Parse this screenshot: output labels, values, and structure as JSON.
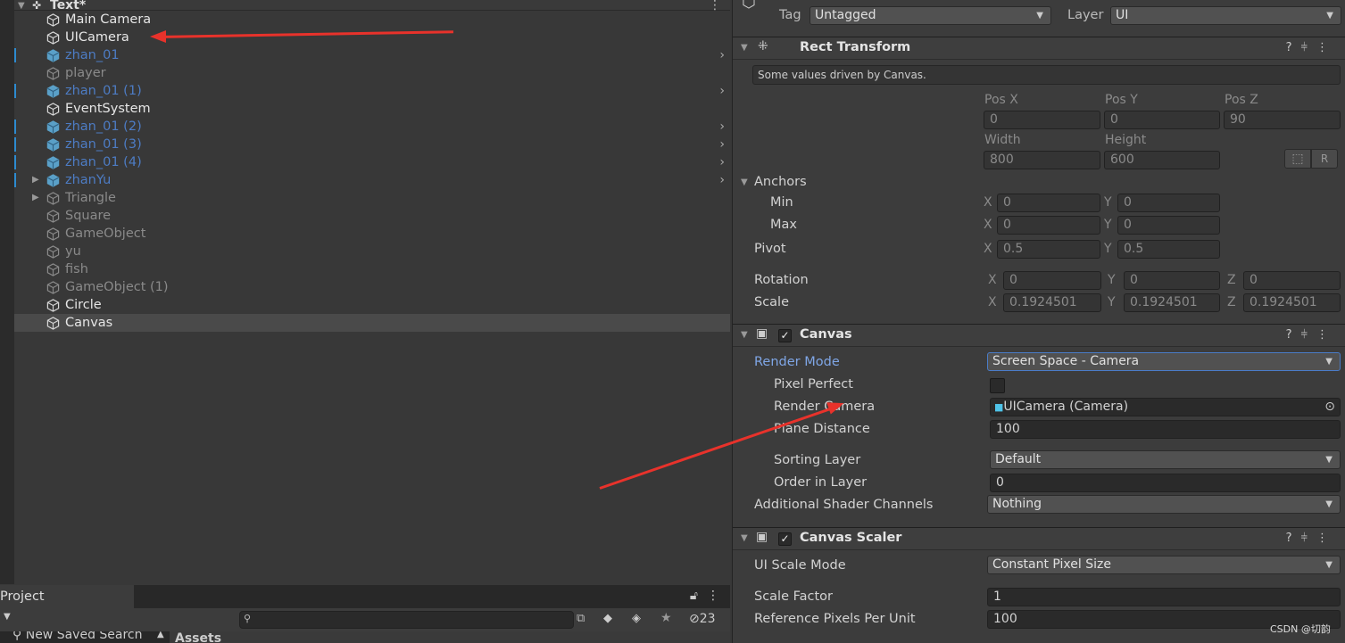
{
  "hierarchy": {
    "scene_name": "Text*",
    "items": [
      {
        "label": "Main Camera",
        "style": "norm"
      },
      {
        "label": "UICamera",
        "style": "norm"
      },
      {
        "label": "zhan_01",
        "style": "pref",
        "chevron": true
      },
      {
        "label": "player",
        "style": "dis"
      },
      {
        "label": "zhan_01 (1)",
        "style": "pref",
        "chevron": true
      },
      {
        "label": "EventSystem",
        "style": "norm"
      },
      {
        "label": "zhan_01 (2)",
        "style": "pref",
        "chevron": true
      },
      {
        "label": "zhan_01 (3)",
        "style": "pref",
        "chevron": true
      },
      {
        "label": "zhan_01 (4)",
        "style": "pref",
        "chevron": true
      },
      {
        "label": "zhanYu",
        "style": "pref",
        "chevron": true,
        "fold": true
      },
      {
        "label": "Triangle",
        "style": "dis",
        "fold": true
      },
      {
        "label": "Square",
        "style": "dis"
      },
      {
        "label": "GameObject",
        "style": "dis"
      },
      {
        "label": "yu",
        "style": "dis"
      },
      {
        "label": "fish",
        "style": "dis"
      },
      {
        "label": "GameObject (1)",
        "style": "dis"
      },
      {
        "label": "Circle",
        "style": "norm"
      },
      {
        "label": "Canvas",
        "style": "norm",
        "selected": true
      }
    ]
  },
  "project": {
    "tab": "Project",
    "saved_search": "New Saved Search",
    "assets": "Assets",
    "hidden_count": "23",
    "search_placeholder": ""
  },
  "inspector": {
    "tag_label": "Tag",
    "tag_value": "Untagged",
    "layer_label": "Layer",
    "layer_value": "UI",
    "rect_transform": {
      "title": "Rect Transform",
      "note": "Some values driven by Canvas.",
      "pos_x_label": "Pos X",
      "pos_y_label": "Pos Y",
      "pos_z_label": "Pos Z",
      "pos_x": "0",
      "pos_y": "0",
      "pos_z": "90",
      "width_label": "Width",
      "height_label": "Height",
      "width": "800",
      "height": "600",
      "anchors": "Anchors",
      "min": "Min",
      "max": "Max",
      "min_x": "0",
      "min_y": "0",
      "max_x": "0",
      "max_y": "0",
      "pivot": "Pivot",
      "pivot_x": "0.5",
      "pivot_y": "0.5",
      "rotation": "Rotation",
      "rot_x": "0",
      "rot_y": "0",
      "rot_z": "0",
      "scale": "Scale",
      "scale_x": "0.1924501",
      "scale_y": "0.1924501",
      "scale_z": "0.1924501",
      "x": "X",
      "y": "Y",
      "z": "Z",
      "r_button": "R"
    },
    "canvas": {
      "title": "Canvas",
      "render_mode_label": "Render Mode",
      "render_mode": "Screen Space - Camera",
      "pixel_perfect_label": "Pixel Perfect",
      "pixel_perfect": false,
      "render_camera_label": "Render Camera",
      "render_camera": "UICamera (Camera)",
      "plane_distance_label": "Plane Distance",
      "plane_distance": "100",
      "sorting_layer_label": "Sorting Layer",
      "sorting_layer": "Default",
      "order_label": "Order in Layer",
      "order": "0",
      "shader_channels_label": "Additional Shader Channels",
      "shader_channels": "Nothing"
    },
    "canvas_scaler": {
      "title": "Canvas Scaler",
      "ui_scale_mode_label": "UI Scale Mode",
      "ui_scale_mode": "Constant Pixel Size",
      "scale_factor_label": "Scale Factor",
      "scale_factor": "1",
      "ref_ppu_label": "Reference Pixels Per Unit",
      "ref_ppu": "100"
    }
  },
  "watermark": "CSDN @切韵",
  "colors": {
    "prefab": "#4d7cc4",
    "annotation_arrow": "#e8322b",
    "selected_row": "#4a4a4a"
  }
}
